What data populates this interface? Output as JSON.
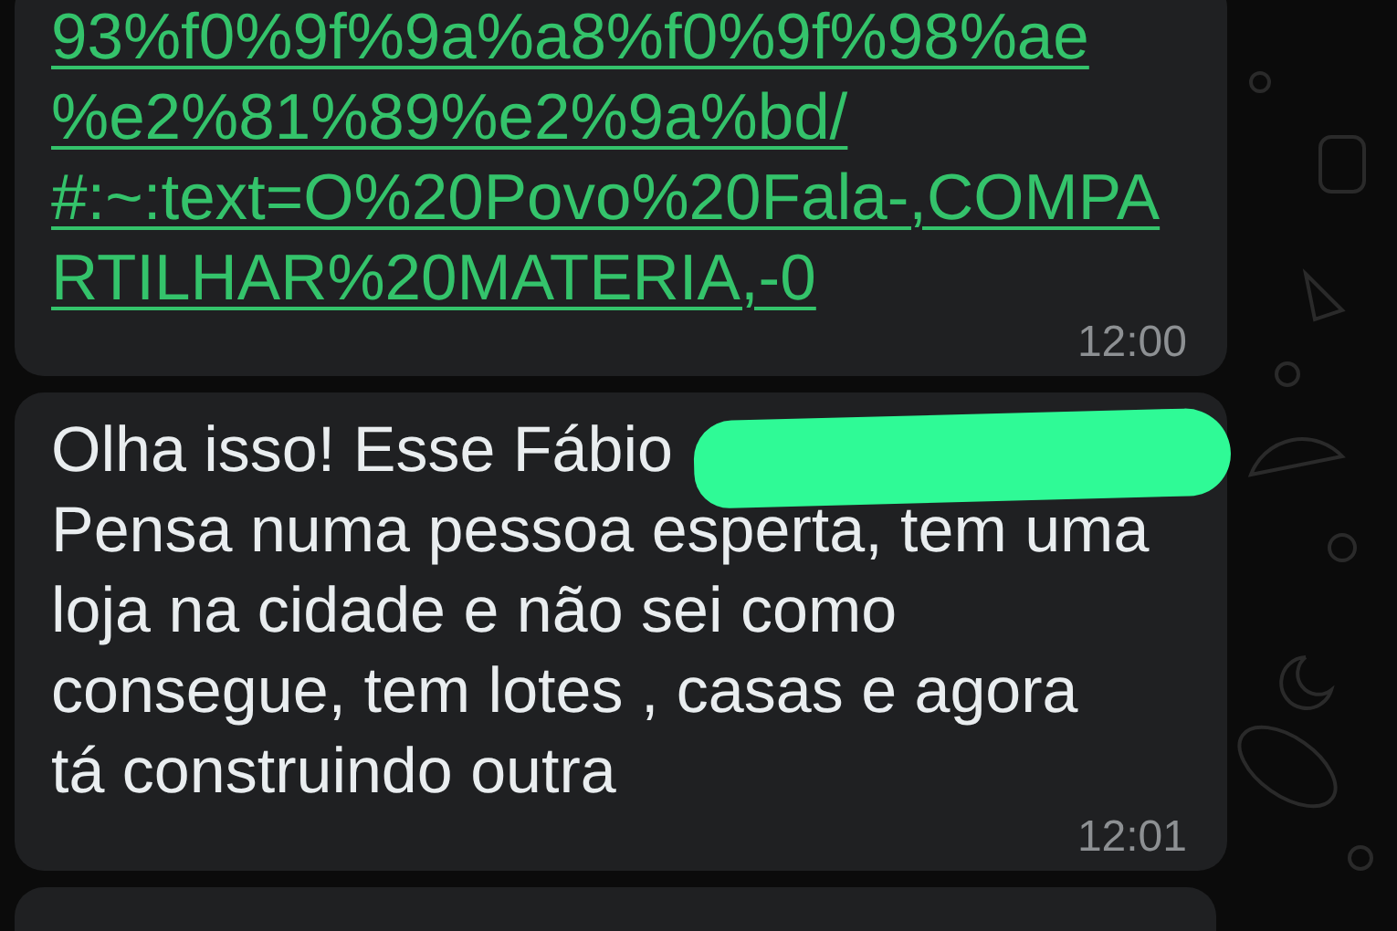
{
  "messages": [
    {
      "kind": "link",
      "text": "93%f0%9f%9a%a8%f0%9f%98%ae\n%e2%81%89%e2%9a%bd/\n#:~:text=O%20Povo%20Fala-,COMPA\nRTILHAR%20MATERIA,-0",
      "time": "12:00",
      "redacted": false
    },
    {
      "kind": "text",
      "text": "Olha isso! Esse Fábio\nPensa numa pessoa esperta, tem uma\nloja na cidade e não sei como\nconsegue, tem lotes , casas e agora\ntá construindo outra",
      "time": "12:01",
      "redacted": true
    },
    {
      "kind": "cut"
    }
  ]
}
